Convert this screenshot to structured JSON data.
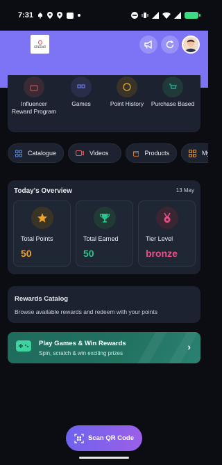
{
  "status": {
    "time": "7:31"
  },
  "logo": {
    "text": "GREENO"
  },
  "categories": [
    {
      "label": "Influencer Reward Program",
      "color": "#c24d4d",
      "bg": "#3a2a35"
    },
    {
      "label": "Games",
      "color": "#6b79e8",
      "bg": "#2a2d48"
    },
    {
      "label": "Point History",
      "color": "#e8b23a",
      "bg": "#3a3428"
    },
    {
      "label": "Purchase Based",
      "color": "#3ab8a2",
      "bg": "#1f3a38"
    }
  ],
  "chips": [
    {
      "label": "Catalogue",
      "icon": "grid-icon",
      "color": "#5b8ef0"
    },
    {
      "label": "Videos",
      "icon": "video-icon",
      "color": "#e05a5a"
    },
    {
      "label": "Products",
      "icon": "calendar-icon",
      "color": "#f08a3a"
    },
    {
      "label": "My P",
      "icon": "grid-icon",
      "color": "#f0a03a"
    }
  ],
  "overview": {
    "title": "Today's Overview",
    "date": "13 May",
    "stats": [
      {
        "label": "Total Points",
        "value": "50",
        "icon": "star-icon",
        "color": "#f2a227",
        "icon_bg": "#3a3426"
      },
      {
        "label": "Total Earned",
        "value": "50",
        "icon": "trophy-icon",
        "color": "#2cc48e",
        "icon_bg": "#1f3b34"
      },
      {
        "label": "Tier Level",
        "value": "bronze",
        "icon": "medal-icon",
        "color": "#e8508a",
        "icon_bg": "#3a2533"
      }
    ]
  },
  "rewards_catalog": {
    "title": "Rewards Catalog",
    "subtitle": "Browse available rewards and redeem with your points"
  },
  "play": {
    "title": "Play Games & Win Rewards",
    "subtitle": "Spin, scratch & win exciting prizes"
  },
  "scan": {
    "label": "Scan QR Code"
  },
  "colors": {
    "header": "#7c73f5",
    "card": "#1c2230",
    "background": "#0b0d12"
  }
}
